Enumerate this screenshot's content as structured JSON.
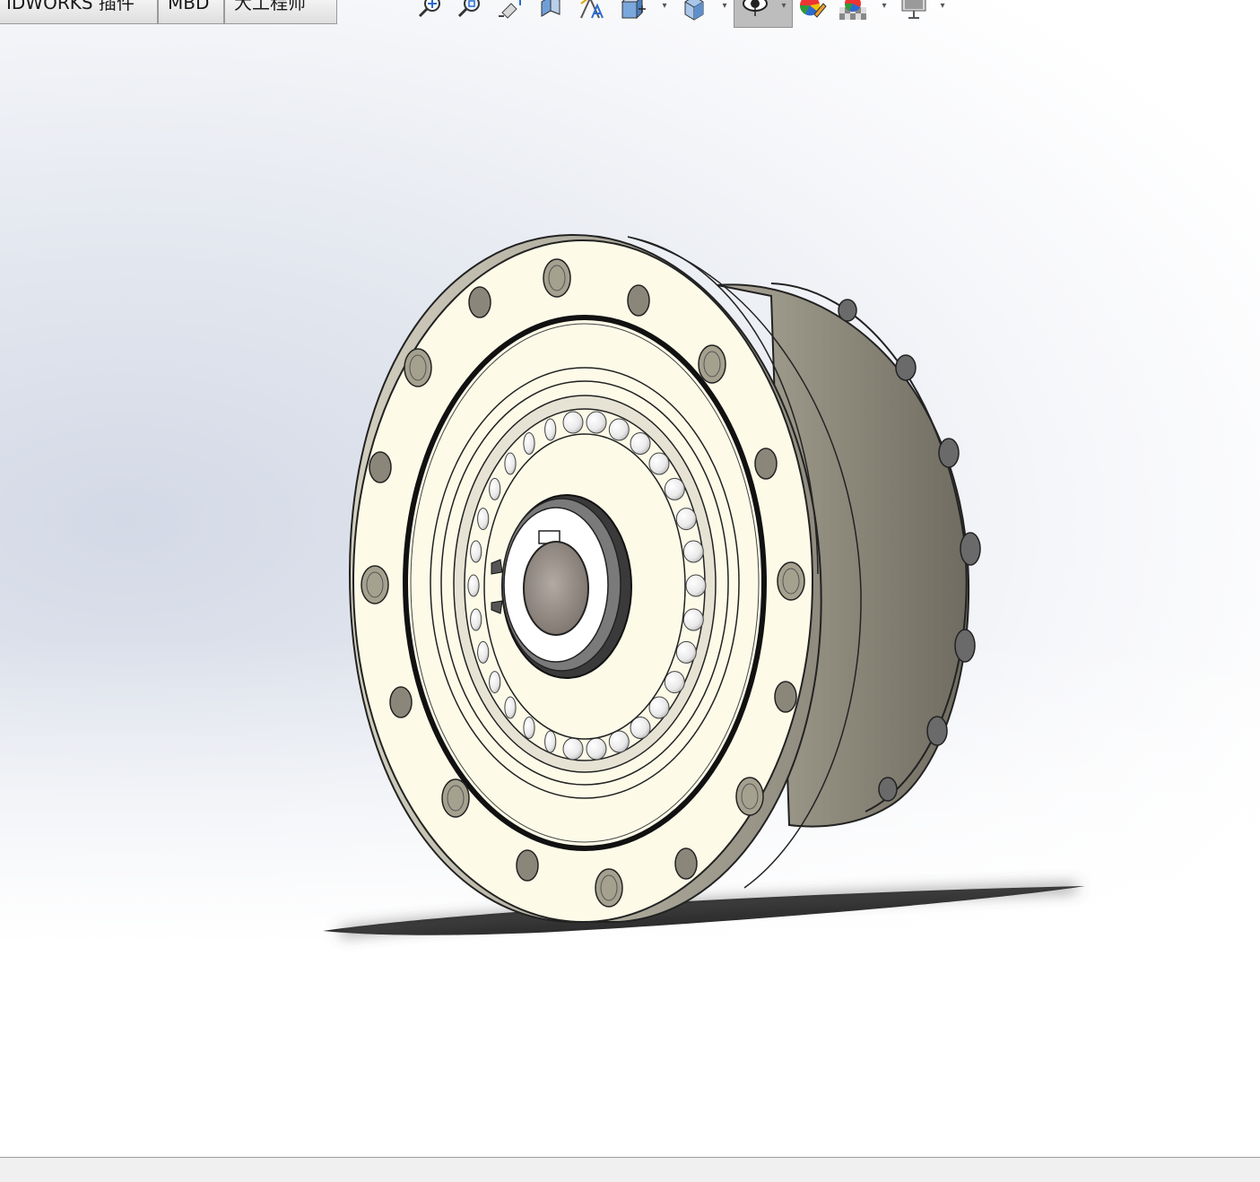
{
  "command_tabs": [
    {
      "label": "IDWORKS 插件"
    },
    {
      "label": "MBD"
    },
    {
      "label": "大工程师"
    }
  ],
  "heads_up_toolbar": {
    "tools": [
      {
        "name": "zoom-to-fit-icon"
      },
      {
        "name": "zoom-to-area-icon"
      },
      {
        "name": "previous-view-icon"
      },
      {
        "name": "section-view-icon"
      },
      {
        "name": "dynamic-annotation-icon"
      },
      {
        "name": "view-orientation-icon",
        "dropdown": true
      },
      {
        "name": "display-style-icon",
        "dropdown": true
      },
      {
        "name": "hide-show-items-icon",
        "dropdown": true,
        "active": true
      },
      {
        "name": "edit-appearance-icon"
      },
      {
        "name": "apply-scene-icon",
        "dropdown": true
      },
      {
        "name": "view-settings-icon",
        "dropdown": true
      }
    ]
  },
  "model": {
    "description_type": "3d-part",
    "colors": {
      "face": "#fdfbe8",
      "housing": "#8e8a7c",
      "housing_light": "#b8b4a6",
      "shadow": "#3a3a3a",
      "bore": "#a09890",
      "edge": "#222222"
    }
  }
}
